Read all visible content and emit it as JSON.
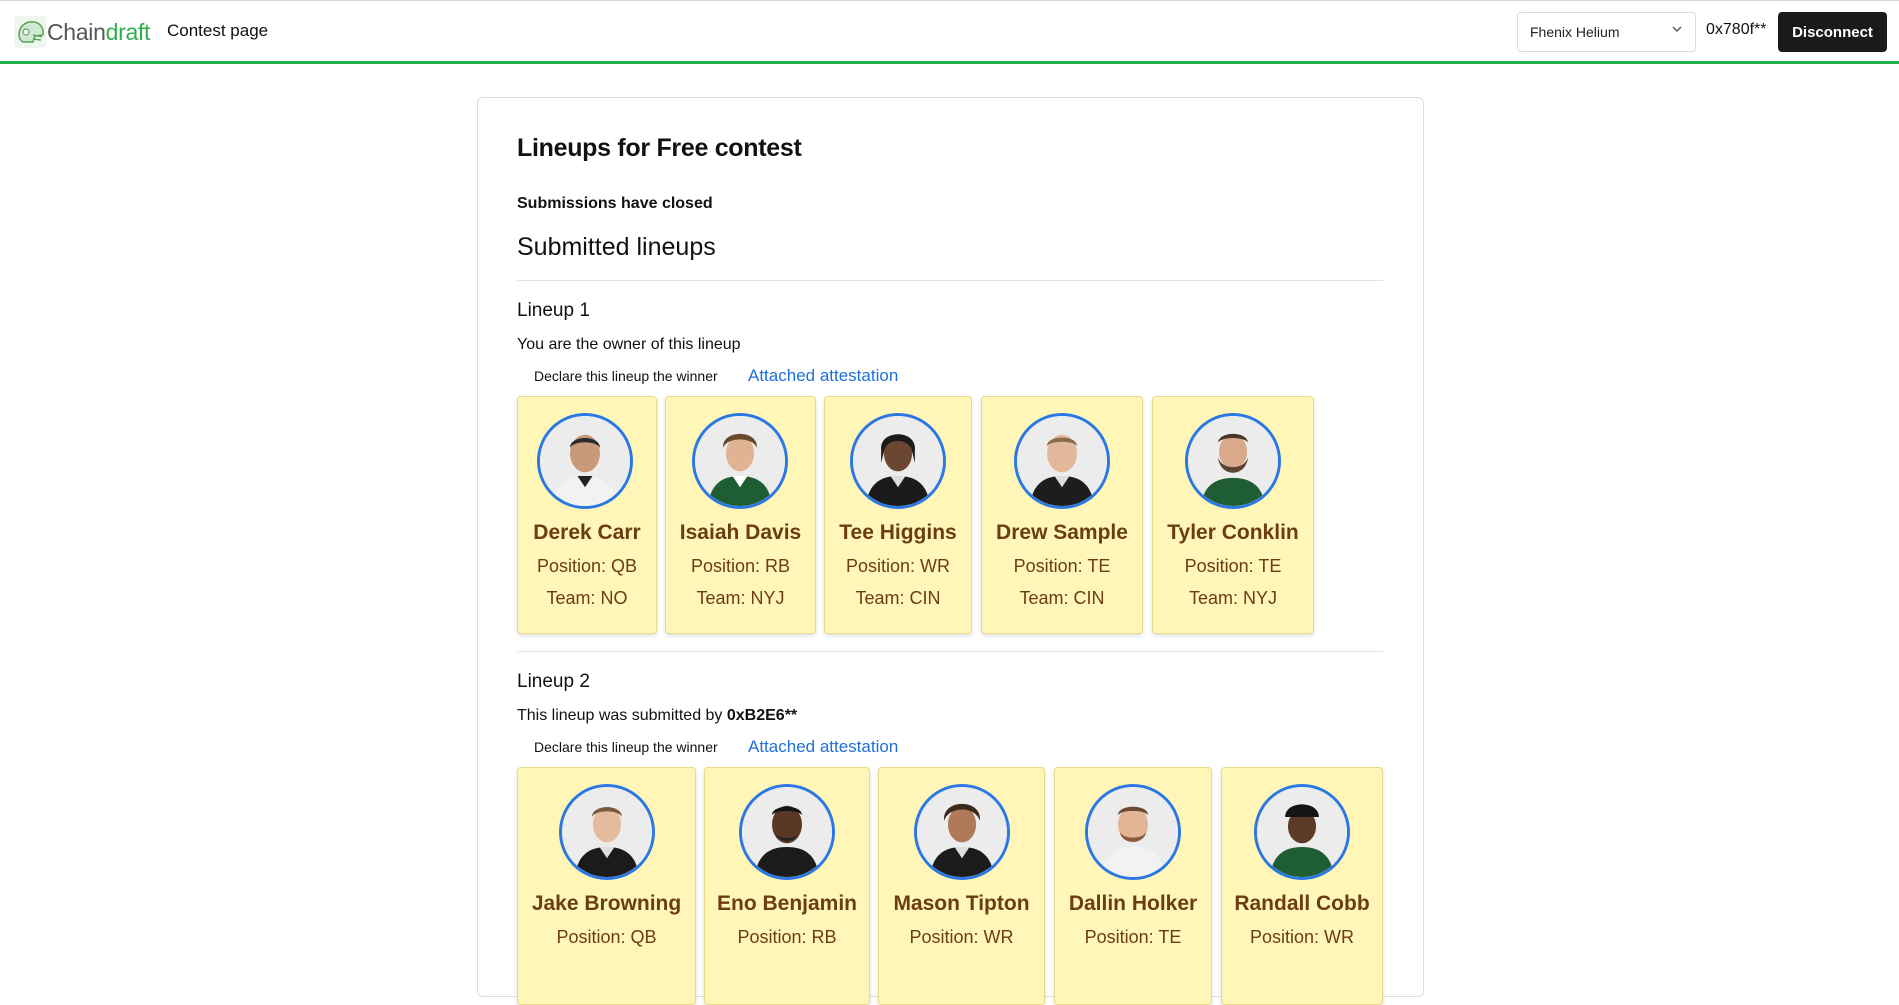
{
  "header": {
    "brand_part1": "Chain",
    "brand_part2": "draft",
    "page_title": "Contest page",
    "network_selected": "Fhenix Helium",
    "address": "0x780f**",
    "disconnect_label": "Disconnect",
    "accent_color": "#22b04b"
  },
  "contest": {
    "title": "Lineups for Free contest",
    "status": "Submissions have closed",
    "section_title": "Submitted lineups"
  },
  "lineups": [
    {
      "title": "Lineup 1",
      "owner_text": "You are the owner of this lineup",
      "declare_label": "Declare this lineup the winner",
      "attestation_label": "Attached attestation",
      "players": [
        {
          "name": "Derek Carr",
          "position": "Position: QB",
          "team": "Team: NO"
        },
        {
          "name": "Isaiah Davis",
          "position": "Position: RB",
          "team": "Team: NYJ"
        },
        {
          "name": "Tee Higgins",
          "position": "Position: WR",
          "team": "Team: CIN"
        },
        {
          "name": "Drew Sample",
          "position": "Position: TE",
          "team": "Team: CIN"
        },
        {
          "name": "Tyler Conklin",
          "position": "Position: TE",
          "team": "Team: NYJ"
        }
      ]
    },
    {
      "title": "Lineup 2",
      "submitted_prefix": "This lineup was submitted by ",
      "submitted_by": "0xB2E6**",
      "declare_label": "Declare this lineup the winner",
      "attestation_label": "Attached attestation",
      "players": [
        {
          "name": "Jake Browning",
          "position": "Position: QB",
          "team": ""
        },
        {
          "name": "Eno Benjamin",
          "position": "Position: RB",
          "team": ""
        },
        {
          "name": "Mason Tipton",
          "position": "Position: WR",
          "team": ""
        },
        {
          "name": "Dallin Holker",
          "position": "Position: TE",
          "team": ""
        },
        {
          "name": "Randall Cobb",
          "position": "Position: WR",
          "team": ""
        }
      ]
    }
  ]
}
